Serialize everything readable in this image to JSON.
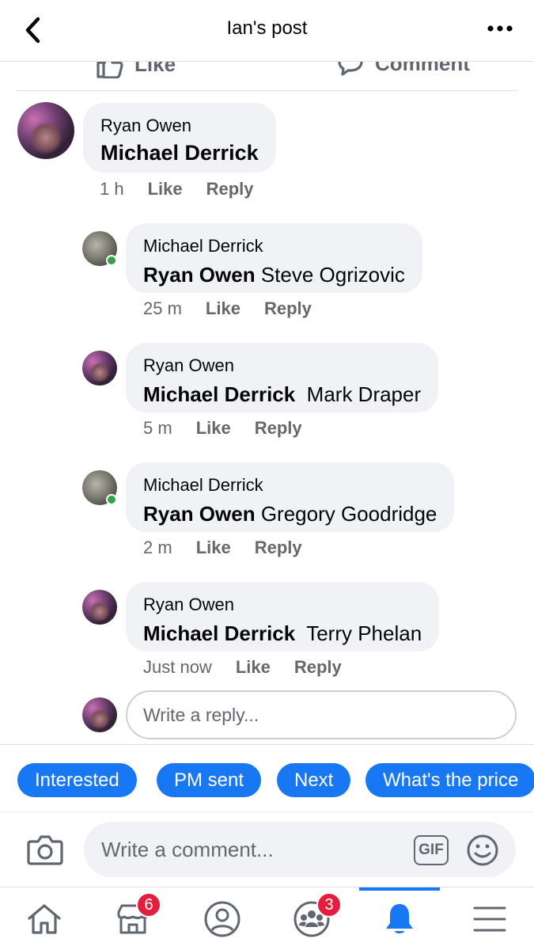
{
  "header": {
    "title": "Ian's post",
    "back_icon": "chevron-left-icon",
    "more_icon": "more-dots-icon"
  },
  "post_actions": {
    "like_label": "Like",
    "comment_label": "Comment"
  },
  "comments": [
    {
      "author": "Ryan Owen",
      "text": "Michael Derrick",
      "time": "1 h",
      "like": "Like",
      "reply": "Reply"
    }
  ],
  "replies": [
    {
      "author": "Michael Derrick",
      "tag": "Ryan Owen",
      "text": " Steve Ogrizovic",
      "time": "25 m",
      "like": "Like",
      "reply": "Reply",
      "online": true
    },
    {
      "author": "Ryan Owen",
      "tag": "Michael Derrick",
      "text": "  Mark Draper",
      "time": "5 m",
      "like": "Like",
      "reply": "Reply",
      "online": false
    },
    {
      "author": "Michael Derrick",
      "tag": "Ryan Owen",
      "text": " Gregory Goodridge",
      "time": "2 m",
      "like": "Like",
      "reply": "Reply",
      "online": true
    },
    {
      "author": "Ryan Owen",
      "tag": "Michael Derrick",
      "text": "  Terry Phelan",
      "time": "Just now",
      "like": "Like",
      "reply": "Reply",
      "online": false
    }
  ],
  "reply_box": {
    "placeholder": "Write a reply..."
  },
  "quick_replies": [
    "Interested",
    "PM sent",
    "Next",
    "What's the price"
  ],
  "composer": {
    "placeholder": "Write a comment...",
    "gif_label": "GIF"
  },
  "tabbar": {
    "items": [
      {
        "icon": "home-icon",
        "badge": ""
      },
      {
        "icon": "marketplace-icon",
        "badge": "6"
      },
      {
        "icon": "profile-icon",
        "badge": ""
      },
      {
        "icon": "groups-icon",
        "badge": "3"
      },
      {
        "icon": "bell-icon",
        "badge": "",
        "active": true
      },
      {
        "icon": "menu-icon",
        "badge": ""
      }
    ]
  },
  "colors": {
    "accent": "#1877f2",
    "bubble": "#f0f2f5",
    "badge": "#e41e3f",
    "online": "#31a24c",
    "meta": "#65676b"
  }
}
